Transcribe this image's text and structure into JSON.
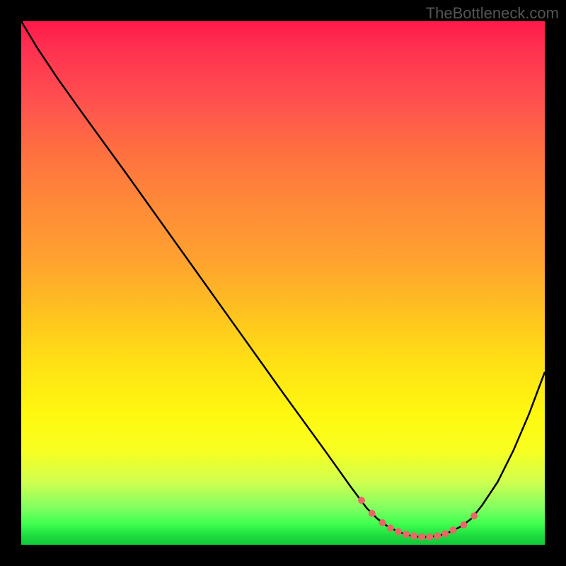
{
  "watermark": "TheBottleneck.com",
  "chart_data": {
    "type": "line",
    "title": "",
    "xlabel": "",
    "ylabel": "",
    "x_range": [
      0,
      100
    ],
    "y_range": [
      0,
      100
    ],
    "curve_points": [
      {
        "x": 0,
        "y": 100
      },
      {
        "x": 3,
        "y": 95
      },
      {
        "x": 7,
        "y": 89
      },
      {
        "x": 12,
        "y": 82
      },
      {
        "x": 20,
        "y": 71
      },
      {
        "x": 30,
        "y": 57
      },
      {
        "x": 40,
        "y": 43
      },
      {
        "x": 50,
        "y": 29
      },
      {
        "x": 58,
        "y": 18
      },
      {
        "x": 63,
        "y": 11
      },
      {
        "x": 66,
        "y": 7
      },
      {
        "x": 68,
        "y": 5
      },
      {
        "x": 70,
        "y": 3.5
      },
      {
        "x": 72,
        "y": 2.5
      },
      {
        "x": 74,
        "y": 1.8
      },
      {
        "x": 76,
        "y": 1.5
      },
      {
        "x": 78,
        "y": 1.5
      },
      {
        "x": 80,
        "y": 1.8
      },
      {
        "x": 82,
        "y": 2.5
      },
      {
        "x": 84,
        "y": 3.5
      },
      {
        "x": 86,
        "y": 5
      },
      {
        "x": 88,
        "y": 7.5
      },
      {
        "x": 91,
        "y": 12
      },
      {
        "x": 94,
        "y": 18
      },
      {
        "x": 97,
        "y": 25
      },
      {
        "x": 100,
        "y": 33
      }
    ],
    "highlight_dots": [
      {
        "x": 65,
        "y": 8.5
      },
      {
        "x": 67,
        "y": 6
      },
      {
        "x": 69,
        "y": 4.2
      },
      {
        "x": 70.5,
        "y": 3.2
      },
      {
        "x": 72,
        "y": 2.5
      },
      {
        "x": 73.5,
        "y": 2
      },
      {
        "x": 75,
        "y": 1.7
      },
      {
        "x": 76.5,
        "y": 1.5
      },
      {
        "x": 78,
        "y": 1.5
      },
      {
        "x": 79.5,
        "y": 1.7
      },
      {
        "x": 81,
        "y": 2.1
      },
      {
        "x": 82.5,
        "y": 2.8
      },
      {
        "x": 84.5,
        "y": 3.8
      },
      {
        "x": 86.5,
        "y": 5.5
      }
    ],
    "colors": {
      "curve": "#000000",
      "dots": "#e86868",
      "gradient_top": "#ff1a4a",
      "gradient_bottom": "#10c838"
    }
  }
}
